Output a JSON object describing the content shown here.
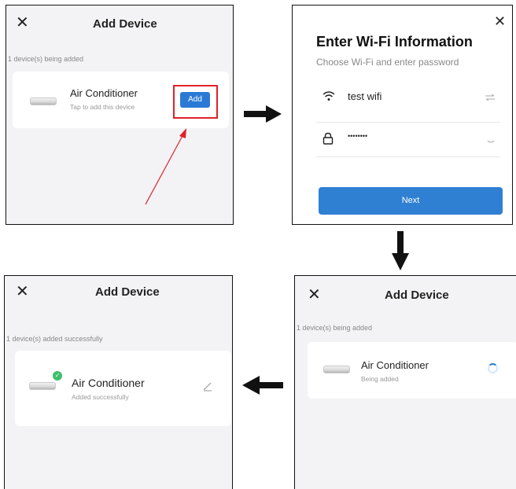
{
  "panel1": {
    "close_glyph": "✕",
    "title": "Add Device",
    "status": "1 device(s) being added",
    "device": {
      "name": "Air Conditioner",
      "subtitle": "Tap to add this device"
    },
    "add_label": "Add"
  },
  "panel2": {
    "close_glyph": "✕",
    "title": "Enter Wi-Fi Information",
    "subtitle": "Choose Wi-Fi and enter password",
    "wifi_name": "test wifi",
    "password_mask": "••••••••",
    "next_label": "Next"
  },
  "panel3": {
    "close_glyph": "✕",
    "title": "Add Device",
    "status": "1 device(s) added successfully",
    "device": {
      "name": "Air Conditioner",
      "subtitle": "Added successfully"
    },
    "check_glyph": "✓"
  },
  "panel4": {
    "close_glyph": "✕",
    "title": "Add Device",
    "status": "1 device(s) being added",
    "device": {
      "name": "Air Conditioner",
      "subtitle": "Being added"
    }
  },
  "colors": {
    "accent": "#2a7ad5",
    "highlight": "#e0202a",
    "success": "#3fbf6a",
    "arrow": "#111111"
  },
  "icons": [
    "close-icon",
    "wifi-icon",
    "lock-icon",
    "swap-icon",
    "chevron-down-icon",
    "edit-icon",
    "check-icon",
    "spinner-icon",
    "arrow-right-icon",
    "arrow-down-icon",
    "arrow-left-icon"
  ]
}
